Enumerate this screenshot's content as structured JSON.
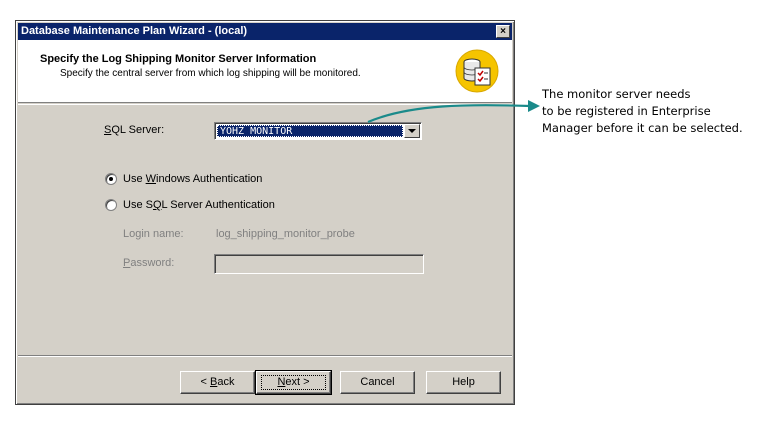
{
  "window": {
    "title": "Database Maintenance Plan Wizard - (local)",
    "close_glyph": "×"
  },
  "header": {
    "title": "Specify the Log Shipping Monitor Server Information",
    "subtitle": "Specify the central server from which log shipping will be monitored.",
    "icon": "database-checklist-icon"
  },
  "form": {
    "sql_server_label": {
      "pre": "",
      "key": "S",
      "post": "QL Server:"
    },
    "sql_server_value": "YOHZ_MONITOR",
    "auth_windows": {
      "pre": "Use ",
      "key": "W",
      "post": "indows Authentication",
      "checked": true
    },
    "auth_sql": {
      "pre": "Use S",
      "key": "Q",
      "post": "L Server Authentication",
      "checked": false
    },
    "login_name_label": "Login name:",
    "login_name_value": "log_shipping_monitor_probe",
    "password_label": {
      "pre": "",
      "key": "P",
      "post": "assword:"
    },
    "password_value": ""
  },
  "buttons": {
    "back": {
      "pre": "< ",
      "key": "B",
      "post": "ack"
    },
    "next": {
      "pre": "",
      "key": "N",
      "post": "ext >"
    },
    "cancel": "Cancel",
    "help": "Help"
  },
  "callout": {
    "lines": [
      "The monitor server needs",
      "to be registered in Enterprise",
      "Manager before it can be selected."
    ],
    "arrow_color": "#1a8a8a"
  },
  "colors": {
    "titlebar": "#0a246a",
    "dialog_face": "#d4d0c8",
    "selection": "#0a246a"
  }
}
